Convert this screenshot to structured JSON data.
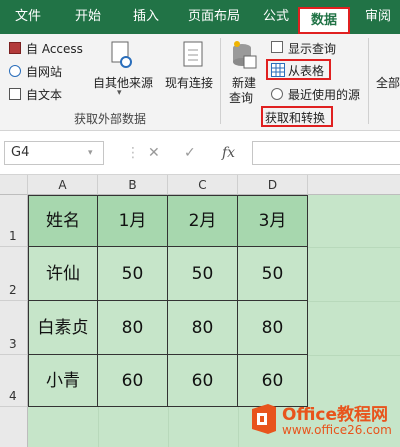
{
  "tabs": [
    {
      "label": "文件"
    },
    {
      "label": "开始"
    },
    {
      "label": "插入"
    },
    {
      "label": "页面布局"
    },
    {
      "label": "公式"
    },
    {
      "label": "数据",
      "active": true
    },
    {
      "label": "审阅"
    }
  ],
  "ribbon": {
    "external_group": {
      "access_label": "自 Access",
      "web_label": "自网站",
      "text_label": "自文本",
      "other_sources_label": "自其他来源",
      "existing_connections_label": "现有连接",
      "group_label": "获取外部数据"
    },
    "transform_group": {
      "new_query_line1": "新建",
      "new_query_line2": "查询",
      "show_queries_label": "显示查询",
      "from_table_label": "从表格",
      "recent_sources_label": "最近使用的源",
      "group_label": "获取和转换"
    },
    "refresh_partial_label": "全部"
  },
  "formula_bar": {
    "name_box": "G4",
    "fx_label": "fx",
    "cancel_label": "✕",
    "confirm_label": "✓"
  },
  "sheet": {
    "columns": [
      "A",
      "B",
      "C",
      "D"
    ],
    "rows": [
      "1",
      "2",
      "3",
      "4"
    ],
    "header_row": [
      "姓名",
      "1月",
      "2月",
      "3月"
    ],
    "data_rows": [
      [
        "许仙",
        "50",
        "50",
        "50"
      ],
      [
        "白素贞",
        "80",
        "80",
        "80"
      ],
      [
        "小青",
        "60",
        "60",
        "60"
      ]
    ]
  },
  "watermark": {
    "brand": "Office教程网",
    "url": "www.office26.com"
  },
  "colors": {
    "ribbon_green": "#217346",
    "highlight_red": "#e02020",
    "cell_green": "#c6e5c9",
    "header_green": "#a7d7ae",
    "office_orange": "#e8541c"
  }
}
